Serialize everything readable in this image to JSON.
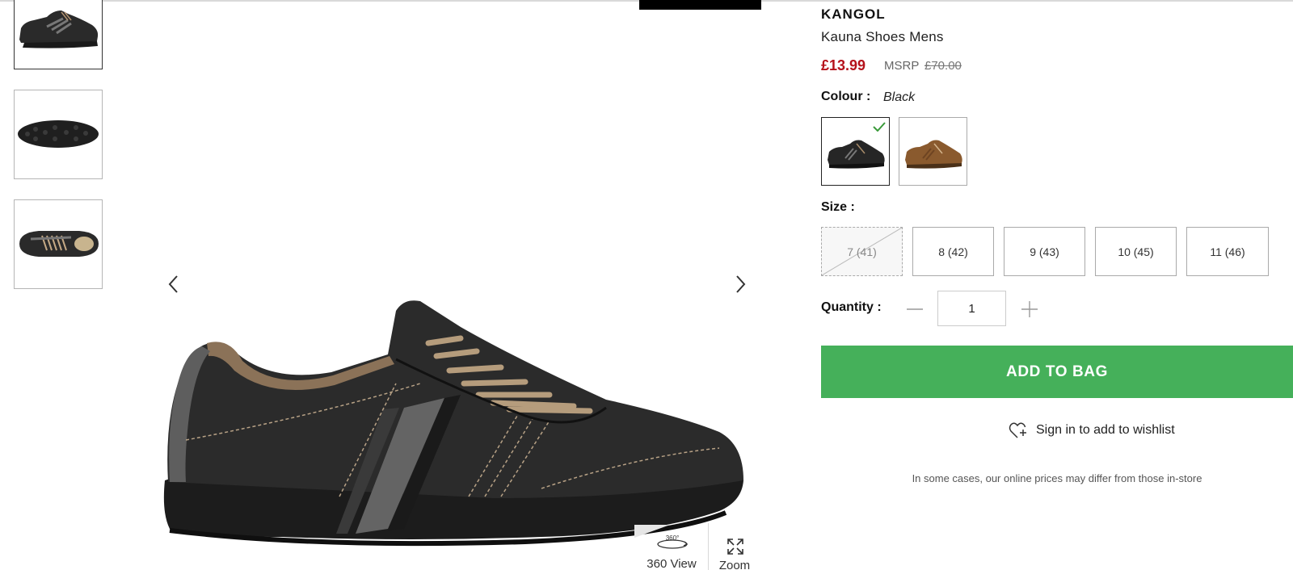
{
  "product": {
    "brand": "KANGOL",
    "name": "Kauna Shoes Mens",
    "price": "£13.99",
    "msrp_label": "MSRP",
    "msrp_value": "£70.00"
  },
  "colour": {
    "label": "Colour :",
    "selected": "Black",
    "swatches": [
      {
        "name": "Black",
        "selected": true,
        "color": "#2b2b2b"
      },
      {
        "name": "Brown",
        "selected": false,
        "color": "#8a5a2e"
      }
    ]
  },
  "size": {
    "label": "Size :",
    "options": [
      {
        "label": "7 (41)",
        "available": false
      },
      {
        "label": "8 (42)",
        "available": true
      },
      {
        "label": "9 (43)",
        "available": true
      },
      {
        "label": "10 (45)",
        "available": true
      },
      {
        "label": "11 (46)",
        "available": true
      }
    ]
  },
  "quantity": {
    "label": "Quantity :",
    "value": "1"
  },
  "actions": {
    "add_to_bag": "ADD TO BAG",
    "wishlist": "Sign in to add to wishlist"
  },
  "disclaimer": "In some cases, our online prices may differ from those in-store",
  "gallery": {
    "view360_label": "360 View",
    "zoom_label": "Zoom",
    "thumbnails": [
      "side-view",
      "sole-view",
      "top-view"
    ]
  },
  "colors": {
    "price_red": "#b5121b",
    "add_to_bag_green": "#45b05a",
    "check_green": "#3a9a3a"
  }
}
